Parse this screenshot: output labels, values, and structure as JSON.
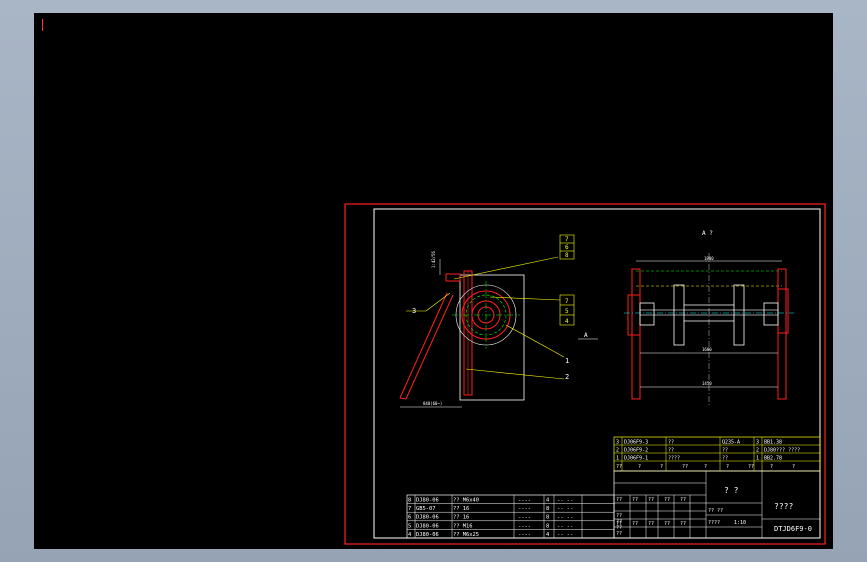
{
  "colors": {
    "background": "#000000",
    "border": "#ff2020",
    "frame": "#ffffff",
    "leader": "#ffff00",
    "centerline": "#00ff00",
    "hidden": "#00ffff",
    "part": "#ff2020"
  },
  "view_label": "A ?",
  "section_label": "A",
  "balloons": {
    "top_stack": [
      "7",
      "6",
      "8"
    ],
    "mid_stack": [
      "7",
      "5",
      "4"
    ],
    "left": "3",
    "right_1": "1",
    "right_2": "2"
  },
  "dimensions": {
    "left_vertical": "1:42/56",
    "bottom_left": "840(60~)",
    "top_right": "1800",
    "mid_right": "1600",
    "bottom_right": "1450"
  },
  "parts_list": [
    {
      "no": "8",
      "code": "DJ80-06",
      "name": "?? M6x40",
      "std": "----",
      "qty": "4",
      "mat": "-- --"
    },
    {
      "no": "7",
      "code": "GB5-07",
      "name": "?? 16",
      "std": "----",
      "qty": "8",
      "mat": "-- --"
    },
    {
      "no": "6",
      "code": "DJ80-06",
      "name": "?? 16",
      "std": "----",
      "qty": "8",
      "mat": "-- --"
    },
    {
      "no": "5",
      "code": "DJ80-06",
      "name": "?? M16",
      "std": "----",
      "qty": "8",
      "mat": "-- --"
    },
    {
      "no": "4",
      "code": "DJ80-06",
      "name": "?? M6x25",
      "std": "----",
      "qty": "4",
      "mat": "-- --"
    }
  ],
  "title_rows": [
    {
      "no": "3",
      "code": "DJ06F9-3",
      "name": "??",
      "mat": "Q235-A",
      "note": "BB1.38"
    },
    {
      "no": "2",
      "code": "DJ06F9-2",
      "name": "??",
      "mat": "??",
      "note": "DJ80??? ????"
    },
    {
      "no": "1",
      "code": "DJ06F9-1",
      "name": "????",
      "mat": "??",
      "note": "BB2.78"
    }
  ],
  "header_row": [
    "??",
    "?",
    "?",
    "??",
    "?",
    "?",
    "??",
    "?",
    "?"
  ],
  "title_block": {
    "part_name": "? ?",
    "company": "????",
    "drawing_no": "DTJD6F9-0",
    "scale_label": "????",
    "scale_value": "1:10",
    "sheet_label": "?? ??",
    "row_labels": [
      "??",
      "??",
      "??",
      "??"
    ],
    "mid_labels": [
      "??",
      "??",
      "??",
      "??",
      "??",
      "??",
      "??",
      "??",
      "??",
      "??"
    ]
  }
}
